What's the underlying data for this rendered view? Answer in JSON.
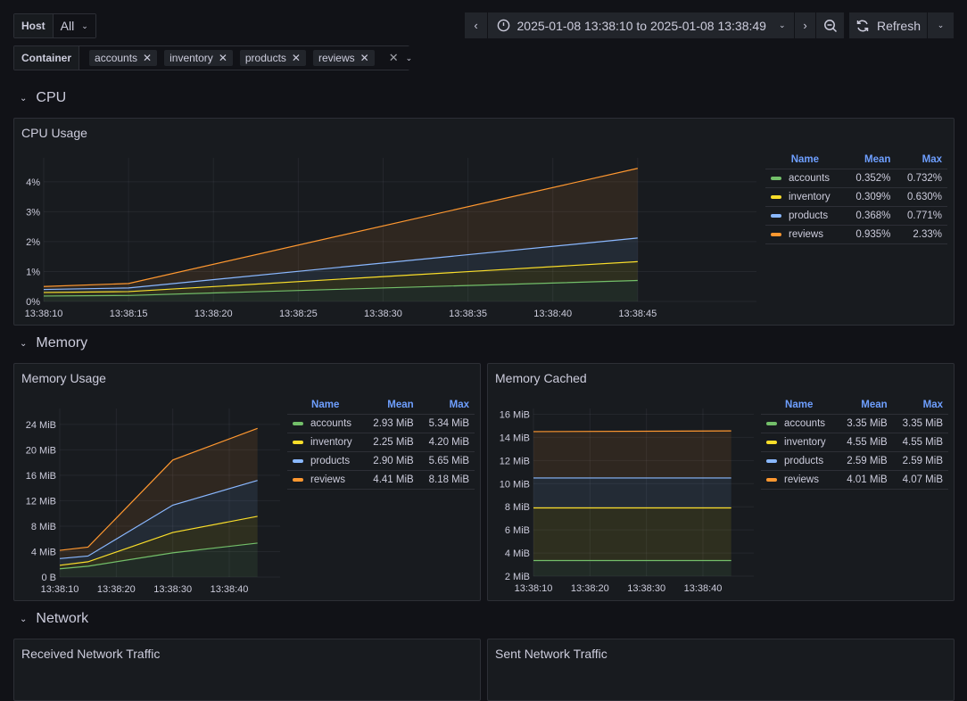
{
  "filters": {
    "host": {
      "label": "Host",
      "value": "All"
    },
    "container": {
      "label": "Container",
      "values": [
        "accounts",
        "inventory",
        "products",
        "reviews"
      ]
    }
  },
  "timepicker": {
    "range": "2025-01-08 13:38:10 to 2025-01-08 13:38:49",
    "refresh_label": "Refresh"
  },
  "sections": {
    "cpu": "CPU",
    "memory": "Memory",
    "network": "Network"
  },
  "legend_headers": {
    "name": "Name",
    "mean": "Mean",
    "max": "Max"
  },
  "colors": {
    "accounts": "#73bf69",
    "inventory": "#fade2a",
    "products": "#8ab8ff",
    "reviews": "#ff9830"
  },
  "panels": {
    "cpu_usage": {
      "title": "CPU Usage",
      "legend": [
        {
          "name": "accounts",
          "mean": "0.352%",
          "max": "0.732%"
        },
        {
          "name": "inventory",
          "mean": "0.309%",
          "max": "0.630%"
        },
        {
          "name": "products",
          "mean": "0.368%",
          "max": "0.771%"
        },
        {
          "name": "reviews",
          "mean": "0.935%",
          "max": "2.33%"
        }
      ]
    },
    "memory_usage": {
      "title": "Memory Usage",
      "legend": [
        {
          "name": "accounts",
          "mean": "2.93 MiB",
          "max": "5.34 MiB"
        },
        {
          "name": "inventory",
          "mean": "2.25 MiB",
          "max": "4.20 MiB"
        },
        {
          "name": "products",
          "mean": "2.90 MiB",
          "max": "5.65 MiB"
        },
        {
          "name": "reviews",
          "mean": "4.41 MiB",
          "max": "8.18 MiB"
        }
      ]
    },
    "memory_cached": {
      "title": "Memory Cached",
      "legend": [
        {
          "name": "accounts",
          "mean": "3.35 MiB",
          "max": "3.35 MiB"
        },
        {
          "name": "inventory",
          "mean": "4.55 MiB",
          "max": "4.55 MiB"
        },
        {
          "name": "products",
          "mean": "2.59 MiB",
          "max": "2.59 MiB"
        },
        {
          "name": "reviews",
          "mean": "4.01 MiB",
          "max": "4.07 MiB"
        }
      ]
    },
    "received_network": {
      "title": "Received Network Traffic"
    },
    "sent_network": {
      "title": "Sent Network Traffic"
    }
  },
  "chart_data": [
    {
      "id": "cpu",
      "type": "area",
      "stacked": true,
      "title": "CPU Usage",
      "x": [
        10,
        15,
        45
      ],
      "xlim": [
        10,
        52
      ],
      "xticks": [
        10,
        15,
        20,
        25,
        30,
        35,
        40,
        45
      ],
      "xtick_labels": [
        "13:38:10",
        "13:38:15",
        "13:38:20",
        "13:38:25",
        "13:38:30",
        "13:38:35",
        "13:38:40",
        "13:38:45"
      ],
      "ylim": [
        0,
        4.8
      ],
      "yticks": [
        0,
        1,
        2,
        3,
        4
      ],
      "ytick_labels": [
        "0%",
        "1%",
        "2%",
        "3%",
        "4%"
      ],
      "series": [
        {
          "name": "accounts",
          "values": [
            0.18,
            0.2,
            0.7
          ]
        },
        {
          "name": "inventory",
          "values": [
            0.12,
            0.13,
            0.63
          ]
        },
        {
          "name": "products",
          "values": [
            0.1,
            0.12,
            0.79
          ]
        },
        {
          "name": "reviews",
          "values": [
            0.1,
            0.15,
            2.33
          ]
        }
      ],
      "grid": true,
      "legend": "right"
    },
    {
      "id": "memusage",
      "type": "area",
      "stacked": true,
      "title": "Memory Usage",
      "x": [
        10,
        15,
        30,
        45
      ],
      "xlim": [
        10,
        49
      ],
      "xticks": [
        10,
        20,
        30,
        40
      ],
      "xtick_labels": [
        "13:38:10",
        "13:38:20",
        "13:38:30",
        "13:38:40"
      ],
      "ylim": [
        0,
        26.5
      ],
      "yticks": [
        0,
        4,
        8,
        12,
        16,
        20,
        24
      ],
      "ytick_labels": [
        "0 B",
        "4 MiB",
        "8 MiB",
        "12 MiB",
        "16 MiB",
        "20 MiB",
        "24 MiB"
      ],
      "series": [
        {
          "name": "accounts",
          "values": [
            1.3,
            1.7,
            3.8,
            5.34
          ]
        },
        {
          "name": "inventory",
          "values": [
            0.55,
            0.7,
            3.2,
            4.2
          ]
        },
        {
          "name": "products",
          "values": [
            1.05,
            0.9,
            4.3,
            5.65
          ]
        },
        {
          "name": "reviews",
          "values": [
            1.3,
            1.4,
            7.1,
            8.18
          ]
        }
      ],
      "grid": true,
      "legend": "right"
    },
    {
      "id": "memcached",
      "type": "area",
      "stacked": true,
      "title": "Memory Cached",
      "x": [
        10,
        45
      ],
      "xlim": [
        10,
        49
      ],
      "xticks": [
        10,
        20,
        30,
        40
      ],
      "xtick_labels": [
        "13:38:10",
        "13:38:20",
        "13:38:30",
        "13:38:40"
      ],
      "ylim": [
        2,
        16.5
      ],
      "yticks": [
        2,
        4,
        6,
        8,
        10,
        12,
        14,
        16
      ],
      "ytick_labels": [
        "2 MiB",
        "4 MiB",
        "6 MiB",
        "8 MiB",
        "10 MiB",
        "12 MiB",
        "14 MiB",
        "16 MiB"
      ],
      "series": [
        {
          "name": "accounts",
          "values": [
            3.35,
            3.35
          ]
        },
        {
          "name": "inventory",
          "values": [
            4.55,
            4.55
          ]
        },
        {
          "name": "products",
          "values": [
            2.59,
            2.59
          ]
        },
        {
          "name": "reviews",
          "values": [
            4.01,
            4.07
          ]
        }
      ],
      "grid": true,
      "legend": "right"
    }
  ]
}
